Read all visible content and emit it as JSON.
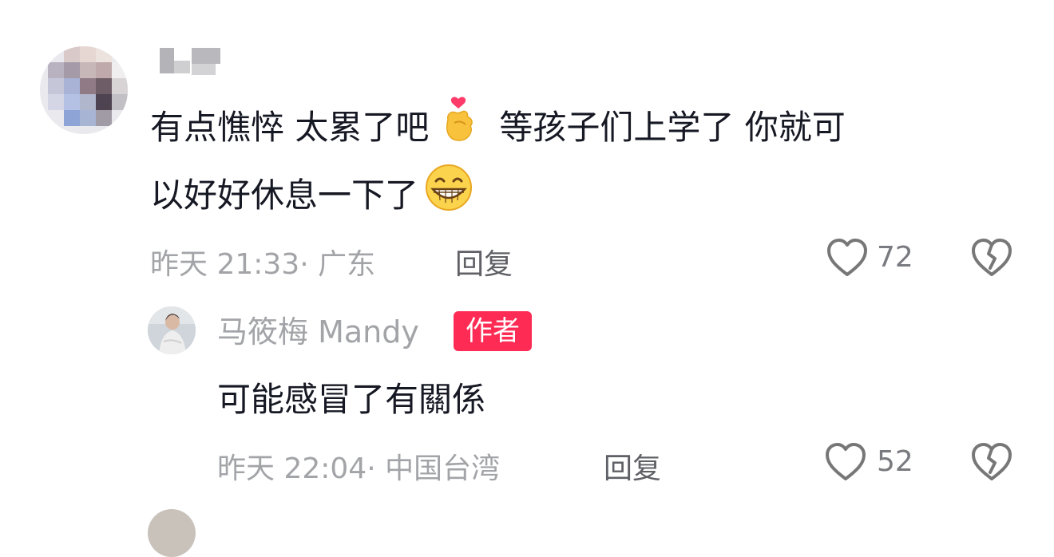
{
  "comments": [
    {
      "text_line1": "有点憔悴 太累了吧",
      "text_mid": "等孩子们上学了 你就可",
      "text_line2": "以好好休息一下了",
      "timestamp": "昨天 21:33· 广东",
      "reply_label": "回复",
      "like_count": "72"
    }
  ],
  "reply": {
    "username": "马筱梅 Mandy",
    "badge": "作者",
    "text": "可能感冒了有關係",
    "timestamp": "昨天 22:04· 中国台湾",
    "reply_label": "回复",
    "like_count": "52"
  },
  "colors": {
    "accent_badge": "#fe2c55",
    "text_primary": "#161823",
    "text_meta": "#a3a4a8"
  },
  "icons": [
    "heart-outline-icon",
    "broken-heart-icon",
    "finger-heart-emoji",
    "grin-emoji"
  ]
}
